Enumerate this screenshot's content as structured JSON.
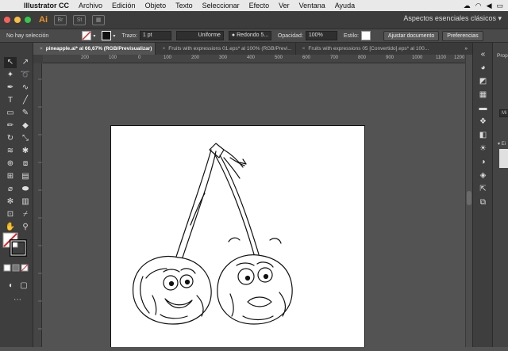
{
  "menubar": {
    "app": "Illustrator CC",
    "items": [
      "Archivo",
      "Edición",
      "Objeto",
      "Texto",
      "Seleccionar",
      "Efecto",
      "Ver",
      "Ventana",
      "Ayuda"
    ]
  },
  "appbar": {
    "logo": "Ai",
    "bridge_label": "Br",
    "stock_label": "St",
    "workspace": "Aspectos esenciales clásicos"
  },
  "controlbar": {
    "selection": "No hay selección",
    "stroke_label": "Trazo:",
    "stroke_value": "1 pt",
    "profile": "Uniforme",
    "brush": "Redondo 5...",
    "opacity_label": "Opacidad:",
    "opacity_value": "100%",
    "style_label": "Estilo:",
    "doc_setup": "Ajustar documento",
    "preferences": "Preferencias"
  },
  "tabs": [
    "pineapple.ai* al 66,67% (RGB/Previsualizar)",
    "Fruits with expressions 01.eps* al 100% (RGB/Previ...",
    "Fruits with expressions 05 [Convertido].eps* al 100..."
  ],
  "ruler_ticks": [
    "200",
    "100",
    "0",
    "100",
    "200",
    "300",
    "400",
    "500",
    "600",
    "700",
    "800",
    "900",
    "1000",
    "1100",
    "1200"
  ],
  "panel": {
    "tab": "Prop",
    "field": "Mi",
    "section": "Ei"
  },
  "colors": {
    "app_bg": "#3c3c3c",
    "canvas": "#535353",
    "accent": "#f29320"
  }
}
